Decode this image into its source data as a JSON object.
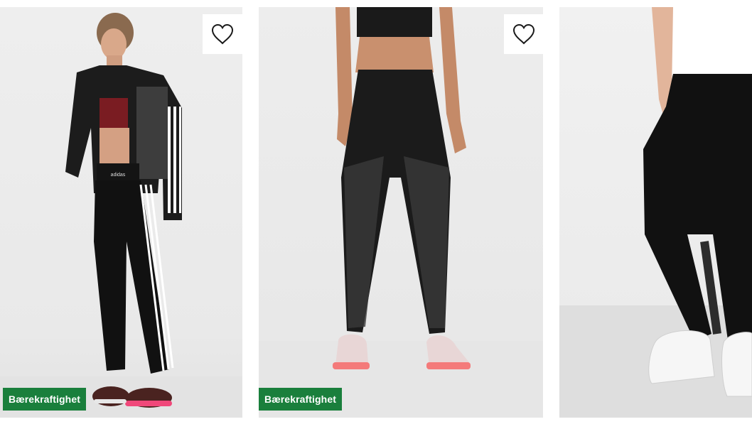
{
  "products": [
    {
      "badge": "Bærekraftighet",
      "wishlist_icon": "heart-outline-icon",
      "colors": {
        "badge_bg": "#1a7f3c",
        "leggings": "#111111",
        "stripe": "#ffffff",
        "top": "#7a1c22",
        "shoe_accent": "#f0487a"
      }
    },
    {
      "badge": "Bærekraftighet",
      "wishlist_icon": "heart-outline-icon",
      "colors": {
        "badge_bg": "#1a7f3c",
        "leggings": "#1b1b1b",
        "pattern": "#3a3a3a",
        "shoe": "#e8d6d6",
        "shoe_accent": "#f47a7a"
      }
    },
    {
      "badge": "",
      "wishlist_icon": "",
      "colors": {
        "top": "#ffffff",
        "leggings": "#111111",
        "shoe": "#f6f6f6"
      }
    }
  ]
}
